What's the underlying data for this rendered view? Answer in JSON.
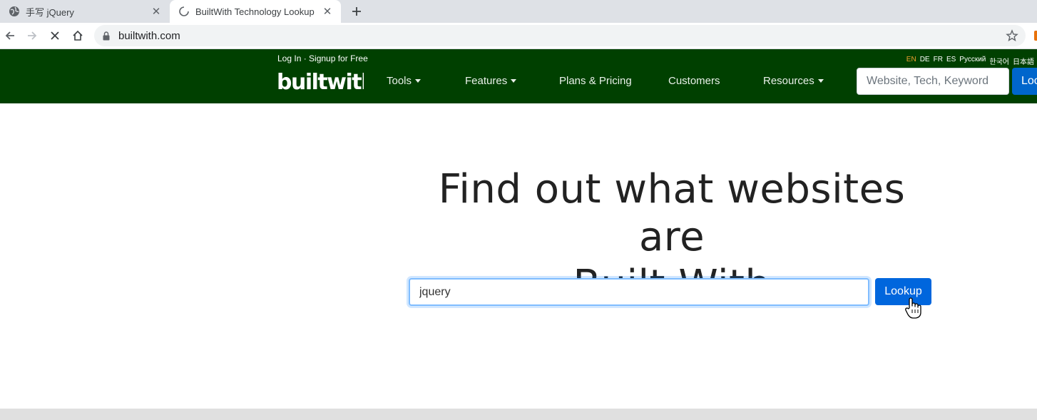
{
  "browser": {
    "tabs": [
      {
        "title": "手写 jQuery",
        "icon": "globe-icon",
        "active": false
      },
      {
        "title": "BuiltWith Technology Lookup",
        "icon": "loading-spinner-icon",
        "active": true
      }
    ],
    "url": "builtwith.com"
  },
  "header": {
    "auth_text": "Log In · Signup for Free",
    "logo_text": "builtwith",
    "nav": [
      {
        "label": "Tools",
        "dropdown": true
      },
      {
        "label": "Features",
        "dropdown": true
      },
      {
        "label": "Plans & Pricing",
        "dropdown": false
      },
      {
        "label": "Customers",
        "dropdown": false
      },
      {
        "label": "Resources",
        "dropdown": true
      }
    ],
    "languages": [
      "EN",
      "DE",
      "FR",
      "ES",
      "Русский",
      "한국어",
      "日本語"
    ],
    "current_language": "EN",
    "search_placeholder": "Website, Tech, Keyword",
    "search_button": "Lookup"
  },
  "hero": {
    "title_line1": "Find out what websites are",
    "title_line2": "Built With",
    "input_value": "jquery",
    "button": "Lookup"
  },
  "colors": {
    "header_bg": "#004000",
    "button_blue": "#0066dd",
    "focus_ring": "#80bdff"
  }
}
